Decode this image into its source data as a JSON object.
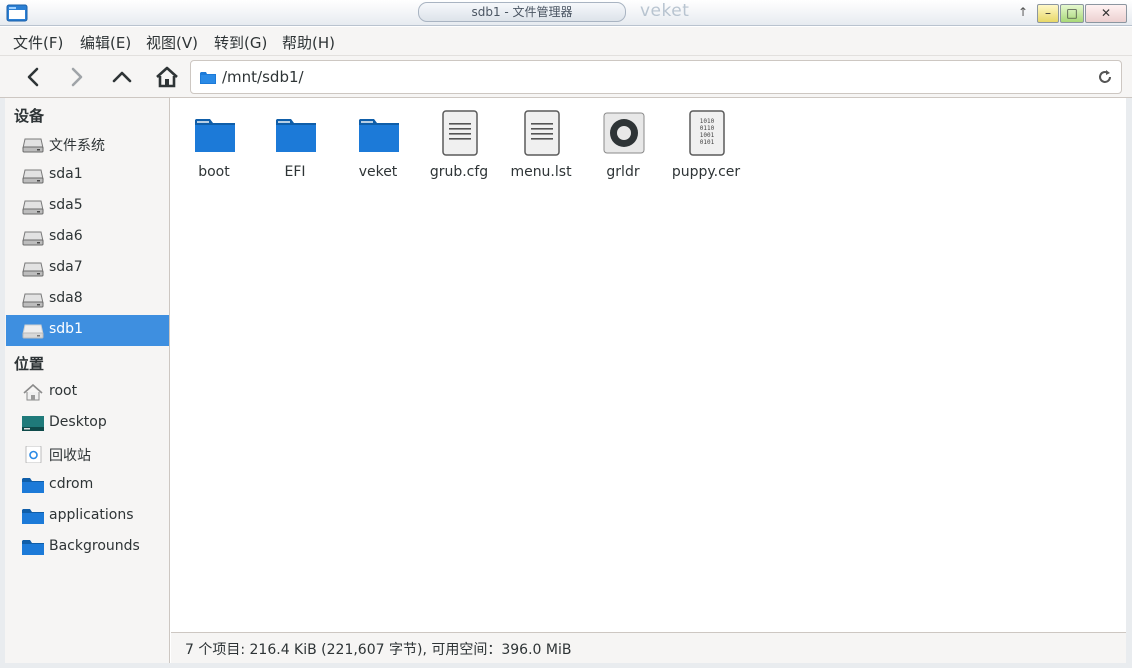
{
  "window": {
    "title": "sdb1 - 文件管理器",
    "wm_label": "veket",
    "controls": {
      "up": "↑",
      "minimize": "–",
      "maximize": "□",
      "close": "✕"
    }
  },
  "menubar": {
    "items": [
      "文件(F)",
      "编辑(E)",
      "视图(V)",
      "转到(G)",
      "帮助(H)"
    ]
  },
  "toolbar": {
    "address_path": "/mnt/sdb1/"
  },
  "sidebar": {
    "devices_heading": "设备",
    "devices": [
      {
        "label": "文件系统",
        "icon": "drive-icon"
      },
      {
        "label": "sda1",
        "icon": "drive-icon"
      },
      {
        "label": "sda5",
        "icon": "drive-icon"
      },
      {
        "label": "sda6",
        "icon": "drive-icon"
      },
      {
        "label": "sda7",
        "icon": "drive-icon"
      },
      {
        "label": "sda8",
        "icon": "drive-icon"
      },
      {
        "label": "sdb1",
        "icon": "drive-icon",
        "selected": true
      }
    ],
    "places_heading": "位置",
    "places": [
      {
        "label": "root",
        "icon": "home-icon"
      },
      {
        "label": "Desktop",
        "icon": "desktop-icon"
      },
      {
        "label": "回收站",
        "icon": "trash-icon"
      },
      {
        "label": "cdrom",
        "icon": "folder-icon"
      },
      {
        "label": "applications",
        "icon": "folder-icon"
      },
      {
        "label": "Backgrounds",
        "icon": "folder-icon"
      }
    ]
  },
  "files": [
    {
      "name": "boot",
      "type": "folder"
    },
    {
      "name": "EFI",
      "type": "folder"
    },
    {
      "name": "veket",
      "type": "folder"
    },
    {
      "name": "grub.cfg",
      "type": "text"
    },
    {
      "name": "menu.lst",
      "type": "text"
    },
    {
      "name": "grldr",
      "type": "executable"
    },
    {
      "name": "puppy.cer",
      "type": "binary"
    }
  ],
  "statusbar": {
    "text": "7 个项目: 216.4 KiB (221,607 字节), 可用空间：396.0 MiB"
  },
  "colors": {
    "selection": "#3e8fe0",
    "folder": "#1c7ad8",
    "folder_dark": "#0f5ea9"
  }
}
